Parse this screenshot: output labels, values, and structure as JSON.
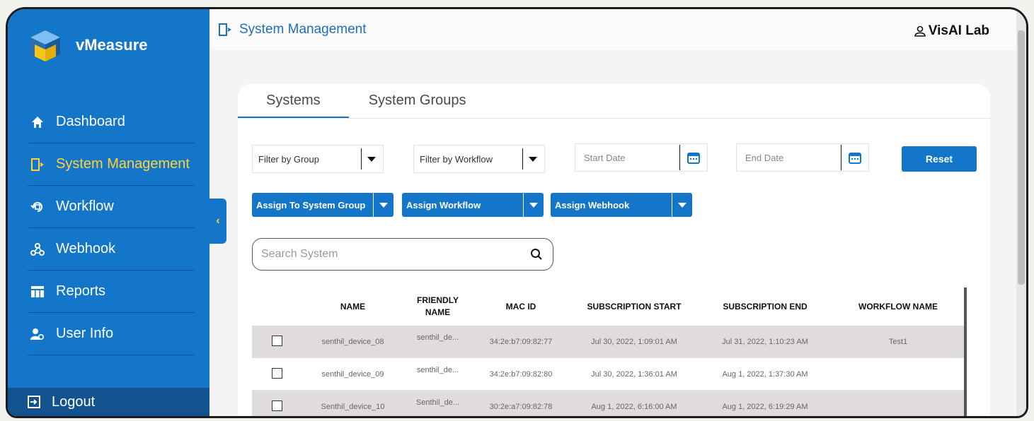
{
  "brand": {
    "name": "vMeasure"
  },
  "sidebar": {
    "items": [
      {
        "label": "Dashboard",
        "icon": "home-icon",
        "active": false
      },
      {
        "label": "System Management",
        "icon": "system-management-icon",
        "active": true
      },
      {
        "label": "Workflow",
        "icon": "workflow-icon",
        "active": false
      },
      {
        "label": "Webhook",
        "icon": "webhook-icon",
        "active": false
      },
      {
        "label": "Reports",
        "icon": "reports-icon",
        "active": false
      },
      {
        "label": "User Info",
        "icon": "user-info-icon",
        "active": false
      }
    ],
    "logout_label": "Logout"
  },
  "header": {
    "title": "System Management",
    "user": "VisAI Lab"
  },
  "tabs": [
    {
      "label": "Systems",
      "active": true
    },
    {
      "label": "System Groups",
      "active": false
    }
  ],
  "filters": {
    "group": "Filter by Group",
    "workflow": "Filter by Workflow",
    "start_date": "Start Date",
    "end_date": "End Date",
    "reset_label": "Reset"
  },
  "actions": {
    "assign_group": "Assign To System Group",
    "assign_workflow": "Assign Workflow",
    "assign_webhook": "Assign Webhook"
  },
  "search": {
    "placeholder": "Search System"
  },
  "table": {
    "headers": [
      "NAME",
      "FRIENDLY NAME",
      "MAC ID",
      "SUBSCRIPTION START",
      "SUBSCRIPTION END",
      "WORKFLOW NAME"
    ],
    "rows": [
      {
        "name": "senthil_device_08",
        "friendly": "senthil_de...",
        "mac": "34:2e:b7:09:82:77",
        "start": "Jul 30, 2022, 1:09:01 AM",
        "end": "Jul 31, 2022, 1:10:23 AM",
        "workflow": "Test1"
      },
      {
        "name": "senthil_device_09",
        "friendly": "senthil_de...",
        "mac": "34:2e:b7:09:82:80",
        "start": "Jul 30, 2022, 1:36:01 AM",
        "end": "Aug 1, 2022, 1:37:30 AM",
        "workflow": ""
      },
      {
        "name": "Senthil_device_10",
        "friendly": "Senthil_de...",
        "mac": "30:2e:a7:09:82:78",
        "start": "Aug 1, 2022, 6:16:00 AM",
        "end": "Aug 1, 2022, 6:19:29 AM",
        "workflow": ""
      }
    ]
  },
  "colors": {
    "primary": "#1476c9",
    "active_nav": "#ffd23a",
    "logout_bg": "#12528f"
  }
}
